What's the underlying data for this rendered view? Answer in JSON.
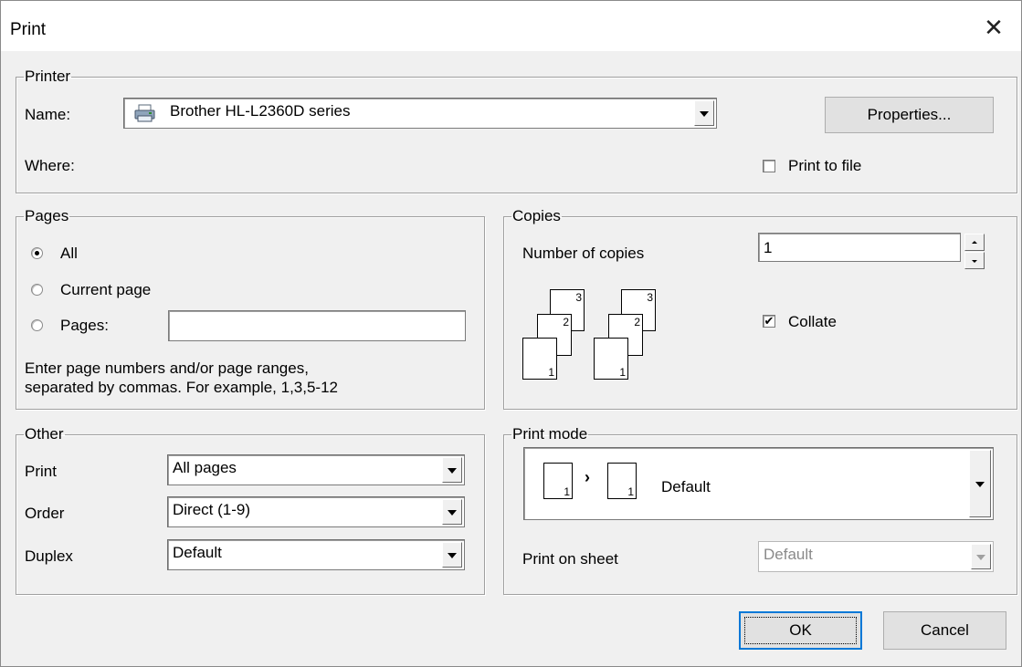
{
  "window": {
    "title": "Print",
    "close_glyph": "✕"
  },
  "printer": {
    "group_label": "Printer",
    "name_label": "Name:",
    "name_value": "Brother HL-L2360D series",
    "where_label": "Where:",
    "properties_label": "Properties...",
    "print_to_file_label": "Print to file",
    "print_to_file_checked": false,
    "printer_icon": "printer-icon"
  },
  "pages": {
    "group_label": "Pages",
    "all_label": "All",
    "current_label": "Current page",
    "pages_label": "Pages:",
    "pages_value": "",
    "selected": "all",
    "hint_line1": "Enter page numbers and/or page ranges,",
    "hint_line2": "separated by commas. For example, 1,3,5-12"
  },
  "copies": {
    "group_label": "Copies",
    "number_label": "Number of copies",
    "number_value": "1",
    "collate_label": "Collate",
    "collate_checked": true,
    "collate_check_glyph": "✔",
    "stack_numbers": [
      "3",
      "2",
      "1"
    ]
  },
  "other": {
    "group_label": "Other",
    "print_label": "Print",
    "print_value": "All pages",
    "order_label": "Order",
    "order_value": "Direct (1-9)",
    "duplex_label": "Duplex",
    "duplex_value": "Default"
  },
  "print_mode": {
    "group_label": "Print mode",
    "mode_value": "Default",
    "page_number": "1",
    "arrow_glyph": "›",
    "sheet_label": "Print on sheet",
    "sheet_value": "Default"
  },
  "buttons": {
    "ok": "OK",
    "cancel": "Cancel"
  }
}
